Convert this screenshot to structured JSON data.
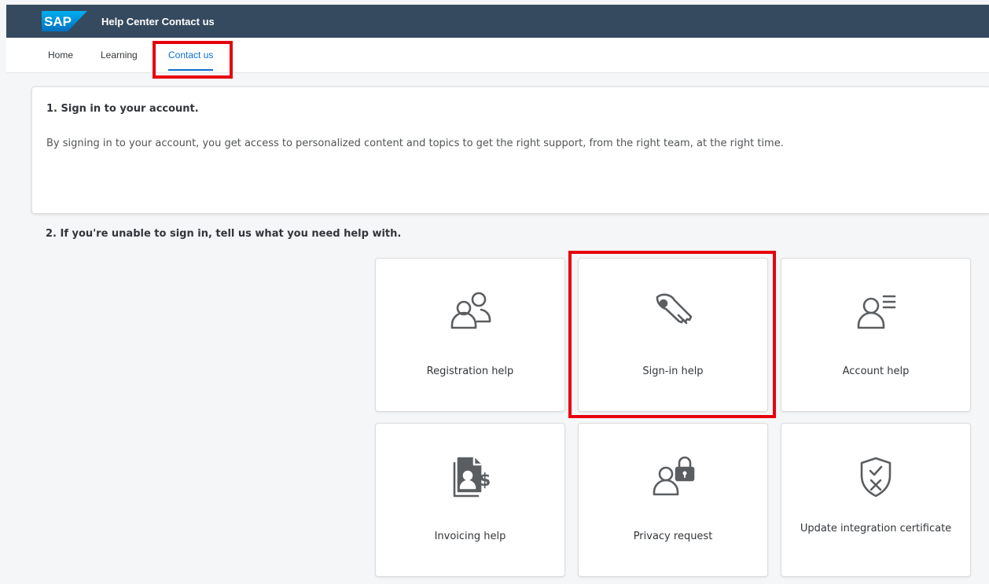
{
  "header": {
    "logo_text": "SAP",
    "app_title": "Help Center Contact us",
    "brand_color": "#354a5f",
    "accent_color": "#0a6ed1",
    "highlight_color": "#e6000e"
  },
  "nav": {
    "tabs": [
      {
        "label": "Home",
        "active": false
      },
      {
        "label": "Learning",
        "active": false
      },
      {
        "label": "Contact us",
        "active": true
      }
    ]
  },
  "signin_section": {
    "heading": "1. Sign in to your account.",
    "description": "By signing in to your account, you get access to personalized content and topics to get the right support, from the right team, at the right time."
  },
  "help_section": {
    "heading": "2. If you're unable to sign in, tell us what you need help with.",
    "tiles": [
      {
        "label": "Registration help",
        "icon": "registration-people-icon"
      },
      {
        "label": "Sign-in help",
        "icon": "key-icon"
      },
      {
        "label": "Account help",
        "icon": "user-list-icon"
      },
      {
        "label": "Invoicing help",
        "icon": "invoice-dollar-icon"
      },
      {
        "label": "Privacy request",
        "icon": "user-lock-icon"
      },
      {
        "label": "Update integration certificate",
        "icon": "shield-check-x-icon"
      }
    ]
  }
}
